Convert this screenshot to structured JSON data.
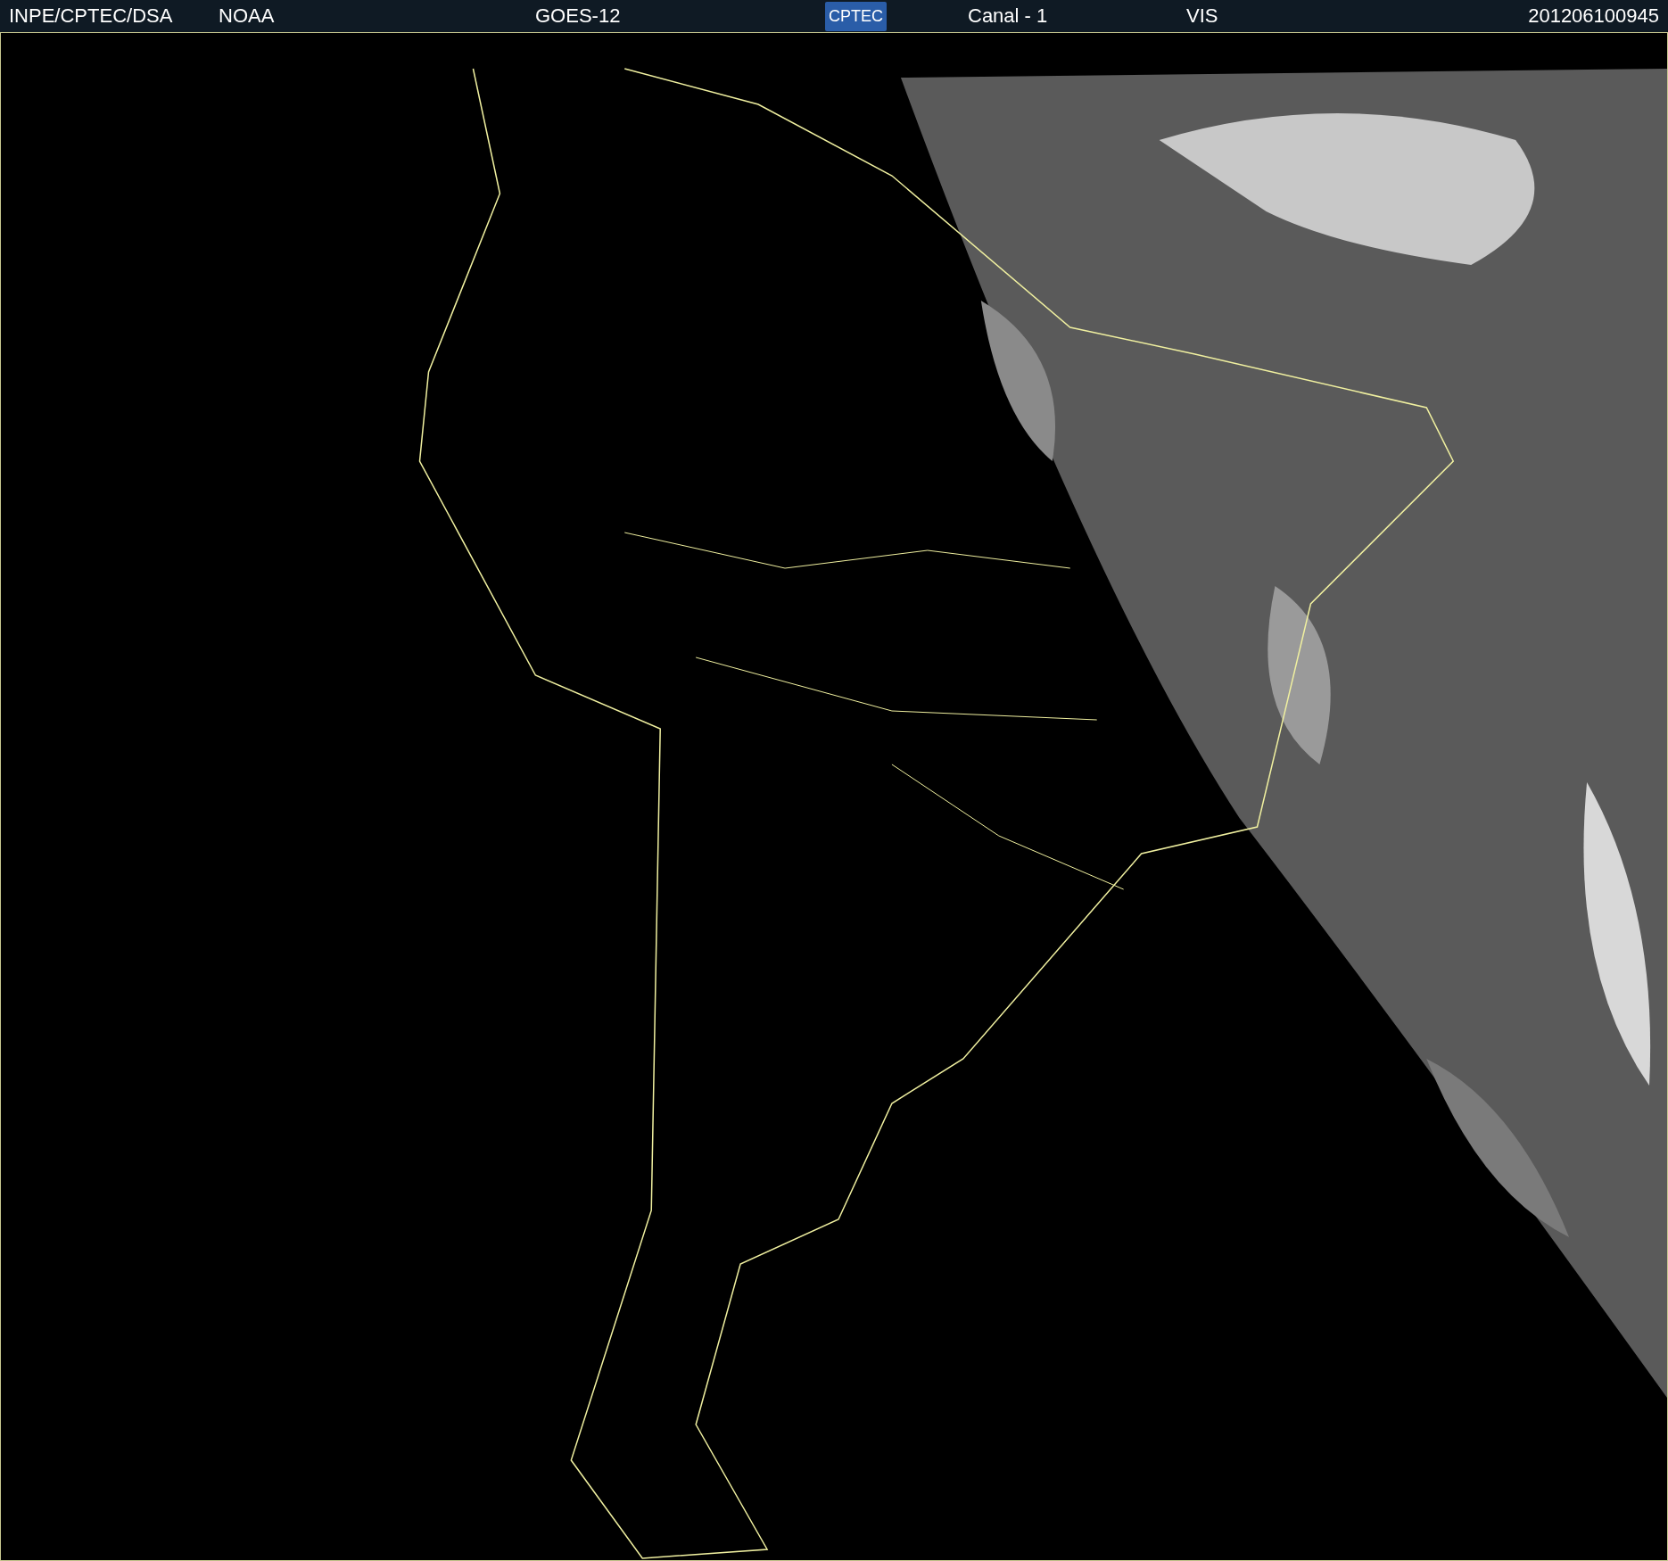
{
  "header": {
    "source": "INPE/CPTEC/DSA",
    "agency": "NOAA",
    "satellite": "GOES-12",
    "logo_text": "CPTEC",
    "channel": "Canal - 1",
    "band": "VIS",
    "timestamp": "201206100945"
  }
}
